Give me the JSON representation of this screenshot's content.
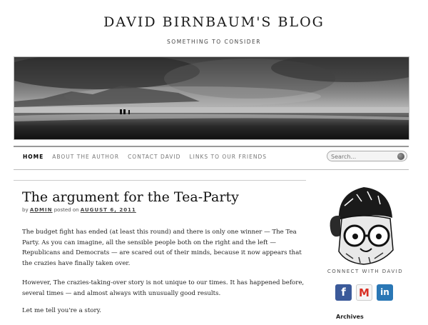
{
  "site": {
    "title": "DAVID BIRNBAUM'S BLOG",
    "tagline": "SOMETHING TO CONSIDER"
  },
  "nav": {
    "items": [
      {
        "label": "HOME",
        "active": true
      },
      {
        "label": "ABOUT THE AUTHOR",
        "active": false
      },
      {
        "label": "CONTACT DAVID",
        "active": false
      },
      {
        "label": "LINKS TO OUR FRIENDS",
        "active": false
      }
    ]
  },
  "search": {
    "placeholder": "Search..."
  },
  "post": {
    "title": "The argument for the Tea-Party",
    "byline_prefix": "by",
    "author": "ADMIN",
    "posted_on": "posted on",
    "date": "AUGUST 6, 2011",
    "paragraphs": [
      "The budget fight has ended (at least this round) and there is only one winner — The Tea Party. As you can imagine, all the sensible people both on the right and the left — Republicans and Democrats — are scared out of their minds, because it now appears that the crazies have finally taken over.",
      "However, The crazies-taking-over story is not unique to our times.  It has happened before, several times — and almost always with unusually good results.",
      "Let me tell you're a story."
    ]
  },
  "sidebar": {
    "connect_label": "CONNECT WITH DAVID",
    "social": [
      {
        "name": "facebook-icon",
        "glyph": "f",
        "color": "#3b5a9a"
      },
      {
        "name": "gmail-icon",
        "glyph": "M",
        "color": "#d93025"
      },
      {
        "name": "linkedin-icon",
        "glyph": "in",
        "color": "#2a77b5"
      }
    ],
    "archives_label": "Archives"
  }
}
